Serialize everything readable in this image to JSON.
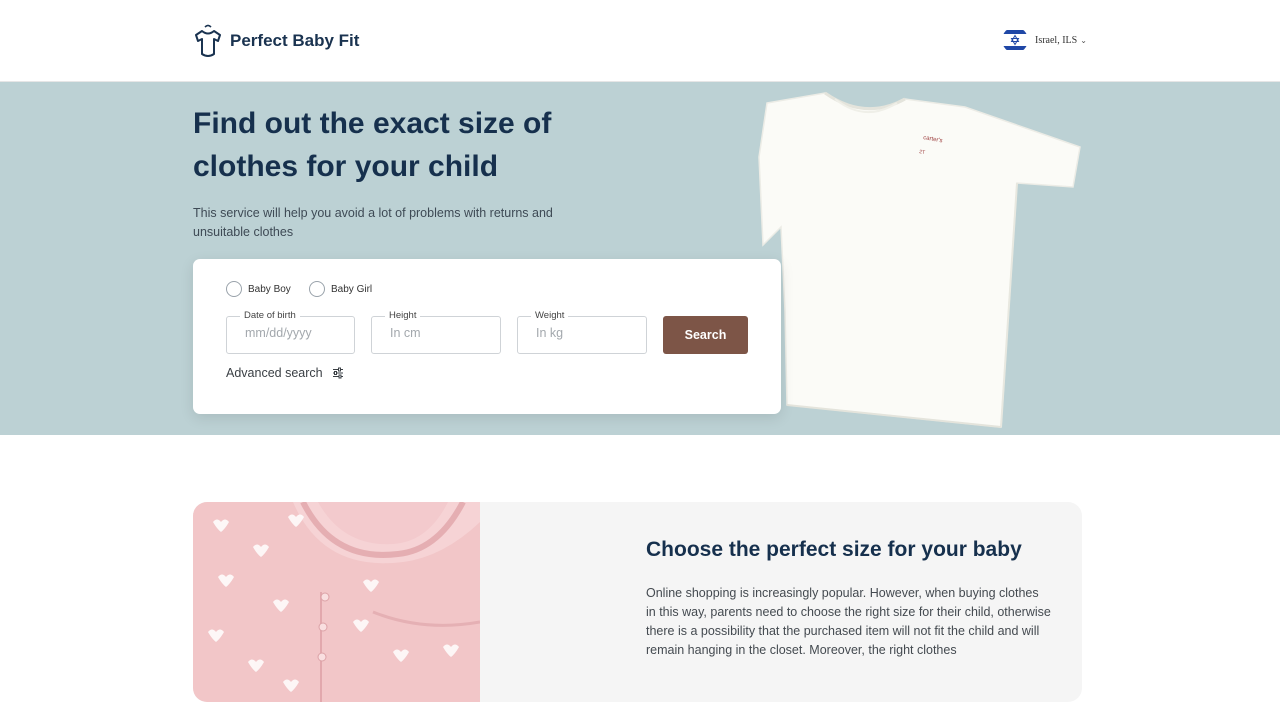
{
  "header": {
    "brand": "Perfect Baby Fit",
    "region": "Israel, ILS",
    "region_chevron": "⌄"
  },
  "hero": {
    "title": "Find out the exact size of clothes for your child",
    "subtitle": "This service will help you avoid a lot of problems with returns and unsuitable clothes",
    "shirt_tag": "carter's"
  },
  "search_form": {
    "gender_options": [
      "Baby Boy",
      "Baby Girl"
    ],
    "date_of_birth": {
      "label": "Date of birth",
      "placeholder": "mm/dd/yyyy",
      "value": ""
    },
    "height": {
      "label": "Height",
      "placeholder": "In cm",
      "value": ""
    },
    "weight": {
      "label": "Weight",
      "placeholder": "In kg",
      "value": ""
    },
    "search_label": "Search",
    "advanced_label": "Advanced search"
  },
  "info": {
    "title": "Choose the perfect size for your baby",
    "text": "Online shopping is increasingly popular. However, when buying clothes in this way, parents need to choose the right size for their child, otherwise there is a possibility that the purchased item will not fit the child and will remain hanging in the closet. Moreover, the right clothes"
  },
  "colors": {
    "hero_bg": "#bcd1d4",
    "brand_navy": "#16304d",
    "search_button": "#7d5547",
    "info_bg": "#f5f5f5",
    "pink_garment": "#f2c4c7"
  },
  "icons": {
    "logo": "onesie-icon",
    "flag": "israel-flag-icon",
    "advanced": "sliders-icon"
  }
}
